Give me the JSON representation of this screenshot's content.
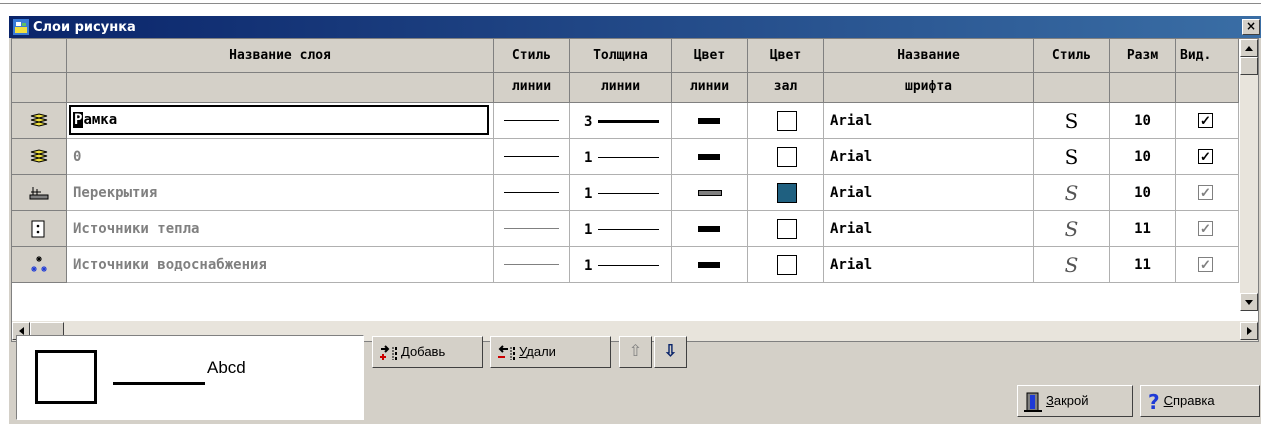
{
  "window": {
    "title": "Слои рисунка",
    "close_label": "×"
  },
  "header": {
    "row1": [
      "Название слоя",
      "Стиль",
      "Толщина",
      "Цвет",
      "Цвет",
      "Название",
      "Стиль",
      "Разм",
      "Вид."
    ],
    "row2": [
      "",
      "линии",
      "линии",
      "линии",
      "зал",
      "шрифта",
      "",
      "",
      ""
    ]
  },
  "layers": [
    {
      "icon": "stacked-layers-icon",
      "name_sel": "Р",
      "name_rest": "амка",
      "line_grey": false,
      "thickness": "3",
      "color_grey": false,
      "fill": "#ffffff",
      "font": "Arial",
      "style": "S",
      "style_italic": false,
      "size": "10",
      "visible": "✓",
      "visible_enabled": true
    },
    {
      "icon": "stacked-layers-icon",
      "name": "0",
      "line_grey": false,
      "thickness": "1",
      "color_grey": false,
      "fill": "#ffffff",
      "font": "Arial",
      "style": "S",
      "style_italic": false,
      "size": "10",
      "visible": "✓",
      "visible_enabled": true
    },
    {
      "icon": "floor-slab-icon",
      "name": "Перекрытия",
      "line_grey": false,
      "thickness": "1",
      "color_grey": true,
      "fill": "#1f6080",
      "font": "Arial",
      "style": "S",
      "style_italic": true,
      "size": "10",
      "visible": "✓",
      "visible_enabled": false
    },
    {
      "icon": "heat-source-icon",
      "name": "Источники тепла",
      "line_grey": true,
      "thickness": "1",
      "color_grey": false,
      "fill": "#ffffff",
      "font": "Arial",
      "style": "S",
      "style_italic": true,
      "size": "11",
      "visible": "✓",
      "visible_enabled": false
    },
    {
      "icon": "water-source-icon",
      "name": "Источники водоснабжения",
      "line_grey": true,
      "thickness": "1",
      "color_grey": false,
      "fill": "#ffffff",
      "font": "Arial",
      "style": "S",
      "style_italic": true,
      "size": "11",
      "visible": "✓",
      "visible_enabled": false
    }
  ],
  "preview": {
    "sample_text": "Abcd"
  },
  "buttons": {
    "add": {
      "hotkey": "Д",
      "rest": "обавь"
    },
    "delete": {
      "hotkey": "У",
      "rest": "дали"
    },
    "close": {
      "hotkey": "З",
      "rest": "акрой"
    },
    "help": {
      "hotkey": "С",
      "rest": "правка"
    },
    "up_arrow": "⇧",
    "down_arrow": "⇩"
  },
  "colors": {
    "titlebar_start": "#0a246a",
    "titlebar_end": "#3a6ea5",
    "fill_teal": "#1f6080",
    "help_icon": "#1e3ad6",
    "add_icon": "#cc0000"
  }
}
